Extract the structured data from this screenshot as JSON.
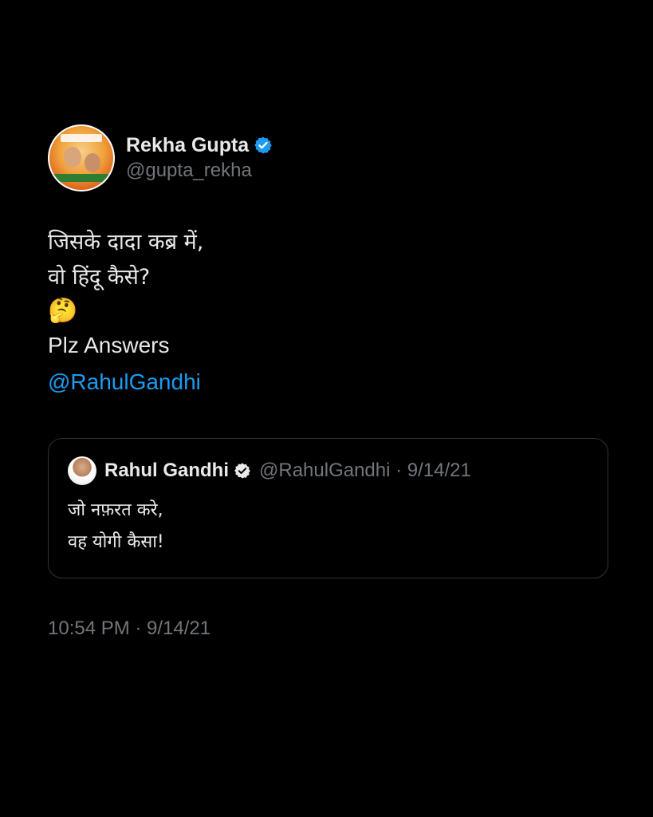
{
  "tweet": {
    "author": {
      "display_name": "Rekha Gupta",
      "handle": "@gupta_rekha",
      "verified_icon": "verified-badge-icon",
      "avatar_icon": "profile-avatar"
    },
    "text_lines": [
      "जिसके दादा कब्र में,",
      "वो हिंदू कैसे?"
    ],
    "emoji": "🤔",
    "plz_line": "Plz Answers",
    "mention": "@RahulGandhi",
    "timestamp": "10:54 PM · 9/14/21"
  },
  "quoted_tweet": {
    "display_name": "Rahul Gandhi",
    "handle_and_date": "@RahulGandhi · 9/14/21",
    "verified_icon": "verified-badge-icon",
    "text_lines": [
      "जो नफ़रत करे,",
      "वह योगी कैसा!"
    ]
  },
  "colors": {
    "background": "#000000",
    "primary_text": "#e7e9ea",
    "secondary_text": "#71767b",
    "accent_blue": "#1d9bf0",
    "border": "#2f3336"
  }
}
